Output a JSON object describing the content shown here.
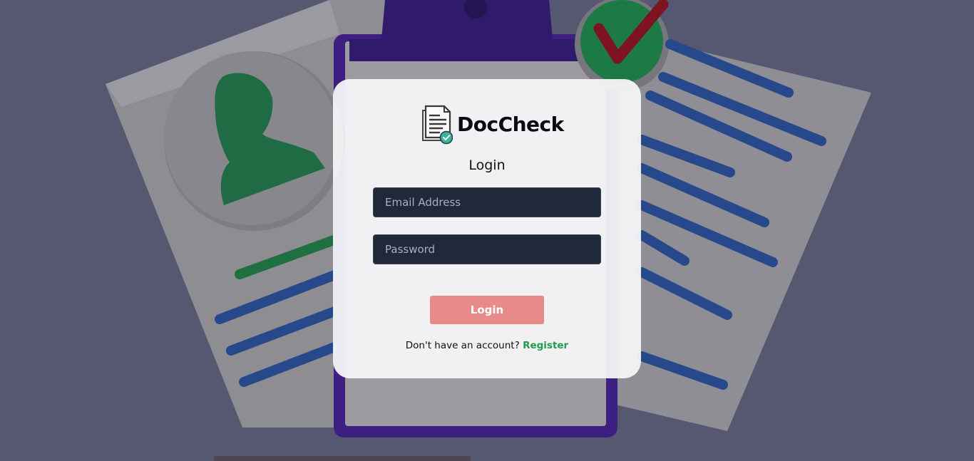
{
  "app": {
    "name": "DocCheck"
  },
  "login": {
    "heading": "Login",
    "email_placeholder": "Email Address",
    "email_value": "",
    "password_placeholder": "Password",
    "password_value": "",
    "submit_label": "Login",
    "no_account_text": "Don't have an account?",
    "register_label": "Register"
  },
  "theme": {
    "page_overlay": "#555870",
    "card_background": "#f6f6f8",
    "input_background": "#202939",
    "button_color": "#e88a8a",
    "link_color": "#1e9e4a",
    "logo_check_color": "#3ab59a"
  },
  "icons": {
    "brand_logo": "document-check-icon",
    "background_avatar": "user-silhouette-icon",
    "background_check": "checkmark-badge-icon"
  }
}
